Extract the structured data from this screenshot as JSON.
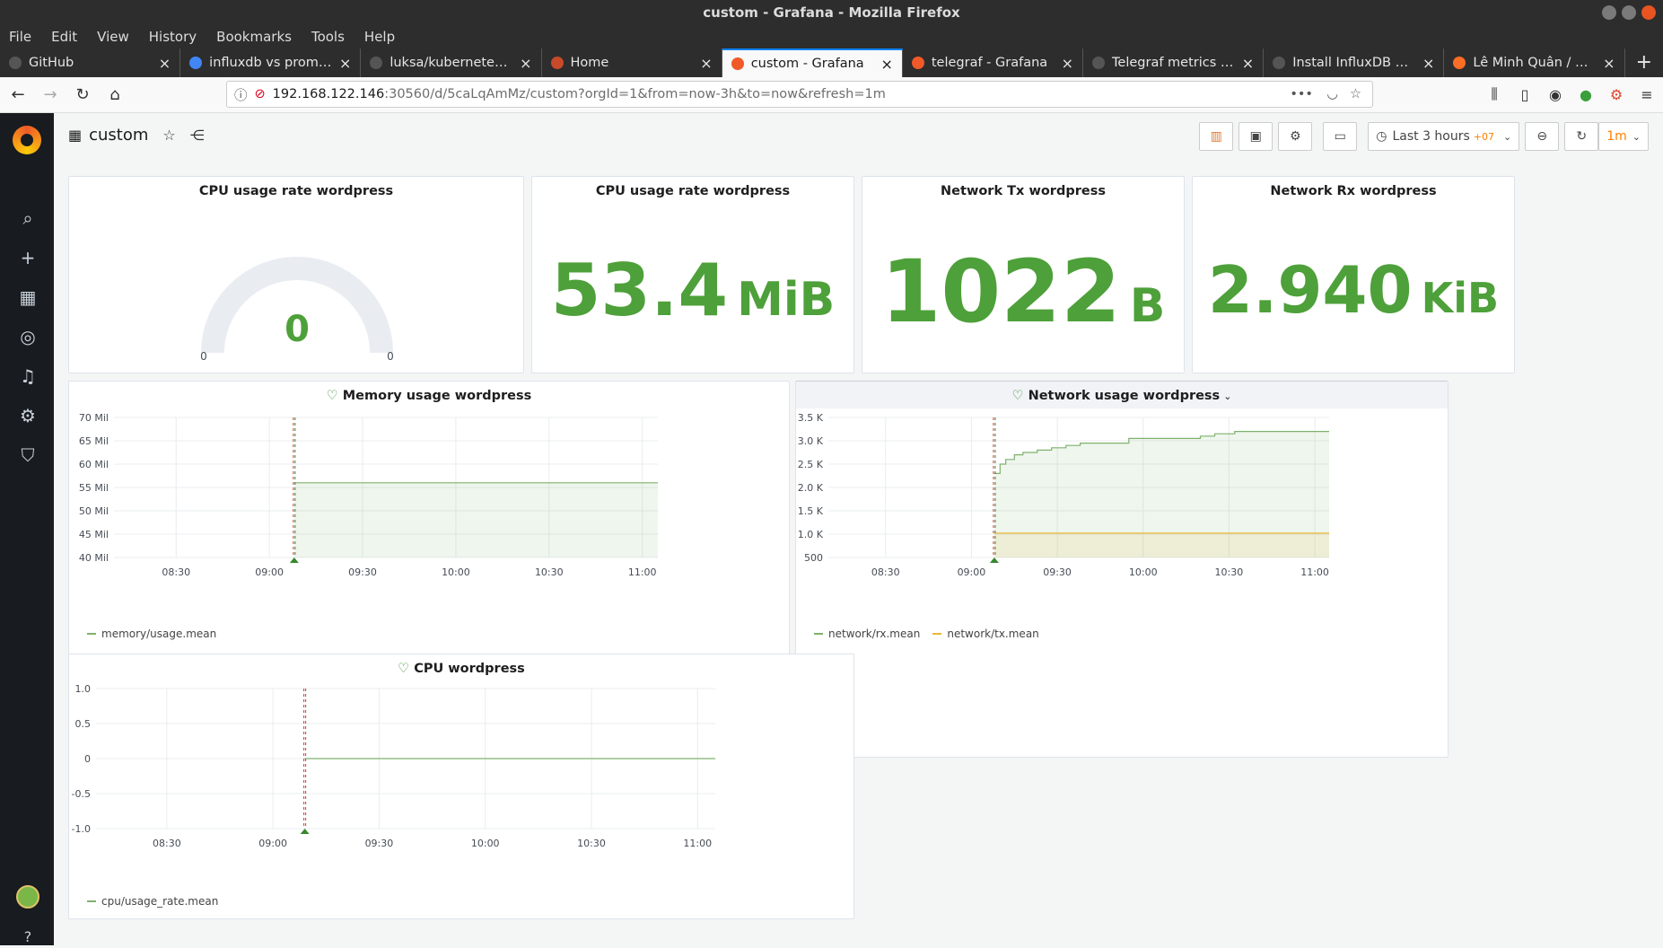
{
  "window": {
    "title": "custom - Grafana - Mozilla Firefox"
  },
  "menu": [
    "File",
    "Edit",
    "View",
    "History",
    "Bookmarks",
    "Tools",
    "Help"
  ],
  "tabs": [
    {
      "label": "GitHub",
      "color": "#555555",
      "active": false
    },
    {
      "label": "influxdb vs promethe",
      "color": "#4285f4",
      "active": false
    },
    {
      "label": "luksa/kubernetes-in-a",
      "color": "#555555",
      "active": false
    },
    {
      "label": "Home",
      "color": "#c94a2a",
      "active": false
    },
    {
      "label": "custom - Grafana",
      "color": "#f05a28",
      "active": true
    },
    {
      "label": "telegraf - Grafana",
      "color": "#f05a28",
      "active": false
    },
    {
      "label": "Telegraf metrics | Infl",
      "color": "#555555",
      "active": false
    },
    {
      "label": "Install InfluxDB OSS |",
      "color": "#555555",
      "active": false
    },
    {
      "label": "Lê Minh Quân / Kube",
      "color": "#fc6d26",
      "active": false
    }
  ],
  "url": {
    "host": "192.168.122.146",
    "rest": ":30560/d/5caLqAmMz/custom?orgId=1&from=now-3h&to=now&refresh=1m"
  },
  "dashboard": {
    "title": "custom",
    "time_range": "Last 3 hours",
    "tz": "+07",
    "refresh": "1m"
  },
  "panels": {
    "gauge": {
      "title": "CPU usage rate wordpress",
      "value": "0",
      "min": "0",
      "max": "0"
    },
    "stat_mem": {
      "title": "CPU usage rate wordpress",
      "value": "53.4",
      "unit": "MiB"
    },
    "stat_tx": {
      "title": "Network Tx wordpress",
      "value": "1022",
      "unit": "B"
    },
    "stat_rx": {
      "title": "Network Rx wordpress",
      "value": "2.940",
      "unit": "KiB"
    },
    "memory": {
      "title": "Memory usage wordpress",
      "legend": [
        "memory/usage.mean"
      ]
    },
    "network": {
      "title": "Network usage wordpress",
      "legend": [
        "network/rx.mean",
        "network/tx.mean"
      ]
    },
    "cpu": {
      "title": "CPU wordpress",
      "legend": [
        "cpu/usage_rate.mean"
      ]
    }
  },
  "chart_data": [
    {
      "type": "area",
      "title": "Memory usage wordpress",
      "x_ticks": [
        "08:30",
        "09:00",
        "09:30",
        "10:00",
        "10:30",
        "11:00"
      ],
      "y_ticks": [
        "40 Mil",
        "45 Mil",
        "50 Mil",
        "55 Mil",
        "60 Mil",
        "65 Mil",
        "70 Mil"
      ],
      "ylim": [
        40,
        70
      ],
      "xlim": [
        "08:10",
        "11:05"
      ],
      "annotation_time": "09:08",
      "series": [
        {
          "name": "memory/usage.mean",
          "color": "#7eb26d",
          "x": [
            "09:08",
            "11:05"
          ],
          "y": [
            56,
            56
          ]
        }
      ]
    },
    {
      "type": "area",
      "title": "Network usage wordpress",
      "x_ticks": [
        "08:30",
        "09:00",
        "09:30",
        "10:00",
        "10:30",
        "11:00"
      ],
      "y_ticks": [
        "500",
        "1.0 K",
        "1.5 K",
        "2.0 K",
        "2.5 K",
        "3.0 K",
        "3.5 K"
      ],
      "ylim": [
        500,
        3500
      ],
      "xlim": [
        "08:10",
        "11:05"
      ],
      "annotation_time": "09:08",
      "series": [
        {
          "name": "network/rx.mean",
          "color": "#7eb26d",
          "x": [
            "09:08",
            "09:10",
            "09:12",
            "09:15",
            "09:18",
            "09:23",
            "09:28",
            "09:33",
            "09:38",
            "09:50",
            "09:55",
            "10:10",
            "10:20",
            "10:25",
            "10:32",
            "11:05"
          ],
          "y": [
            2300,
            2500,
            2600,
            2700,
            2750,
            2800,
            2850,
            2900,
            2950,
            2950,
            3050,
            3050,
            3100,
            3150,
            3200,
            3200
          ]
        },
        {
          "name": "network/tx.mean",
          "color": "#eab839",
          "x": [
            "09:08",
            "11:05"
          ],
          "y": [
            1022,
            1022
          ]
        }
      ]
    },
    {
      "type": "line",
      "title": "CPU wordpress",
      "x_ticks": [
        "08:30",
        "09:00",
        "09:30",
        "10:00",
        "10:30",
        "11:00"
      ],
      "y_ticks": [
        "-1.0",
        "-0.5",
        "0",
        "0.5",
        "1.0"
      ],
      "ylim": [
        -1,
        1
      ],
      "xlim": [
        "08:10",
        "11:05"
      ],
      "annotation_time": "09:09",
      "series": [
        {
          "name": "cpu/usage_rate.mean",
          "color": "#7eb26d",
          "x": [
            "09:09",
            "11:05"
          ],
          "y": [
            0,
            0
          ]
        }
      ]
    }
  ]
}
